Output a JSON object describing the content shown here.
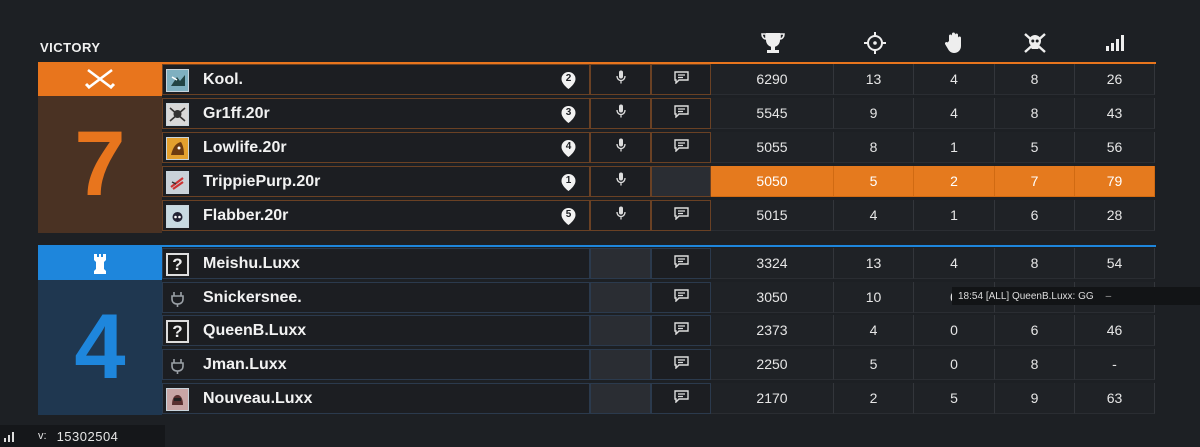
{
  "result": "VICTORY",
  "stat_columns": [
    "score-trophy-icon",
    "kills-crosshair-icon",
    "assists-hand-icon",
    "deaths-skull-icon",
    "ping-bars-icon"
  ],
  "colors": {
    "orange": "#e8751d",
    "blue": "#1e86dc",
    "highlight": "#e57a1e"
  },
  "teams": [
    {
      "score": "7",
      "emblem": "crossed-swords-icon",
      "color": "#e8751d",
      "players": [
        {
          "name": "Kool.",
          "avatar": "operator",
          "rank": "2",
          "chat": true,
          "score": "6290",
          "kills": "13",
          "assists": "4",
          "deaths": "8",
          "ping": "26"
        },
        {
          "name": "Gr1ff.20r",
          "avatar": "operator",
          "rank": "3",
          "chat": true,
          "score": "5545",
          "kills": "9",
          "assists": "4",
          "deaths": "8",
          "ping": "43"
        },
        {
          "name": "Lowlife.20r",
          "avatar": "operator",
          "rank": "4",
          "chat": true,
          "score": "5055",
          "kills": "8",
          "assists": "1",
          "deaths": "5",
          "ping": "56"
        },
        {
          "name": "TrippiePurp.20r",
          "avatar": "operator",
          "rank": "1",
          "chat": false,
          "score": "5050",
          "kills": "5",
          "assists": "2",
          "deaths": "7",
          "ping": "79",
          "highlight": true
        },
        {
          "name": "Flabber.20r",
          "avatar": "operator",
          "rank": "5",
          "chat": true,
          "score": "5015",
          "kills": "4",
          "assists": "1",
          "deaths": "6",
          "ping": "28"
        }
      ]
    },
    {
      "score": "4",
      "emblem": "rook-tower-icon",
      "color": "#1e86dc",
      "players": [
        {
          "name": "Meishu.Luxx",
          "avatar": "?",
          "chat": true,
          "score": "3324",
          "kills": "13",
          "assists": "4",
          "deaths": "8",
          "ping": "54"
        },
        {
          "name": "Snickersnee.",
          "avatar": "plug",
          "chat": true,
          "score": "3050",
          "kills": "10",
          "assists": "0",
          "deaths": "",
          "ping": ""
        },
        {
          "name": "QueenB.Luxx",
          "avatar": "?",
          "chat": true,
          "score": "2373",
          "kills": "4",
          "assists": "0",
          "deaths": "6",
          "ping": "46"
        },
        {
          "name": "Jman.Luxx",
          "avatar": "plug",
          "chat": true,
          "score": "2250",
          "kills": "5",
          "assists": "0",
          "deaths": "8",
          "ping": "-"
        },
        {
          "name": "Nouveau.Luxx",
          "avatar": "operator",
          "chat": true,
          "score": "2170",
          "kills": "2",
          "assists": "5",
          "deaths": "9",
          "ping": "63"
        }
      ]
    }
  ],
  "chat_popup": {
    "time": "18:54",
    "channel": "[ALL]",
    "message": "QueenB.Luxx: GG",
    "trail": "–"
  },
  "footer": {
    "version_label": "v:",
    "version": "15302504"
  }
}
